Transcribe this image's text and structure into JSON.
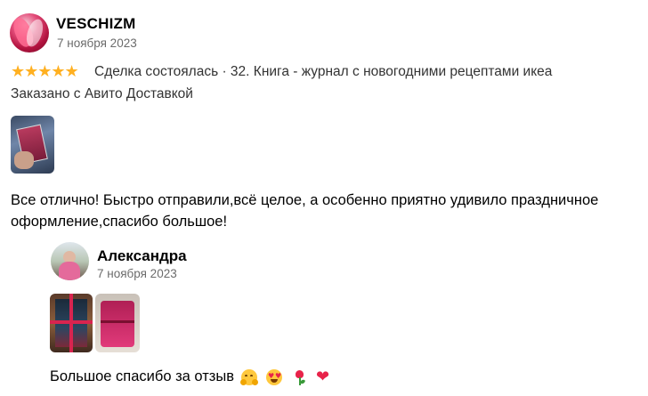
{
  "review": {
    "author": "VESCHIZM",
    "date": "7 ноября 2023",
    "stars": "★★★★★",
    "rating": 5,
    "deal": "Сделка состоялась · 32. Книга - журнал с новогодними рецептами икеа",
    "delivery": "Заказано с Авито Доставкой",
    "text": "Все отлично! Быстро отправили,всё целое, а особенно приятно удивило праздничное оформление,спасибо большое!"
  },
  "reply": {
    "author": "Александра",
    "date": "7 ноября 2023",
    "text": "Большое спасибо за отзыв",
    "emojis": [
      "hugging-face",
      "heart-eyes-face",
      "tulip",
      "red-heart"
    ],
    "heart_char": "❤"
  },
  "colors": {
    "stars": "#ffb021",
    "secondary_text": "#6b6b6b",
    "heart": "#e8234a"
  }
}
